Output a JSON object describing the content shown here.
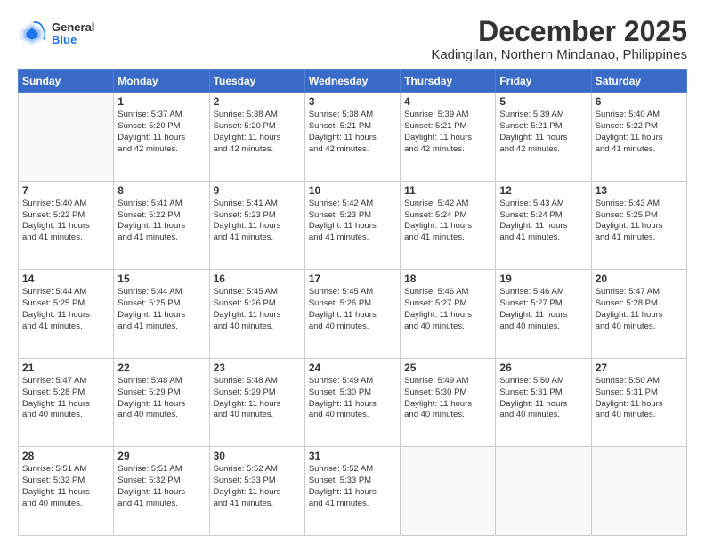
{
  "logo": {
    "general": "General",
    "blue": "Blue"
  },
  "title": "December 2025",
  "subtitle": "Kadingilan, Northern Mindanao, Philippines",
  "days_of_week": [
    "Sunday",
    "Monday",
    "Tuesday",
    "Wednesday",
    "Thursday",
    "Friday",
    "Saturday"
  ],
  "weeks": [
    [
      {
        "day": "",
        "content": ""
      },
      {
        "day": "1",
        "content": "Sunrise: 5:37 AM\nSunset: 5:20 PM\nDaylight: 11 hours\nand 42 minutes."
      },
      {
        "day": "2",
        "content": "Sunrise: 5:38 AM\nSunset: 5:20 PM\nDaylight: 11 hours\nand 42 minutes."
      },
      {
        "day": "3",
        "content": "Sunrise: 5:38 AM\nSunset: 5:21 PM\nDaylight: 11 hours\nand 42 minutes."
      },
      {
        "day": "4",
        "content": "Sunrise: 5:39 AM\nSunset: 5:21 PM\nDaylight: 11 hours\nand 42 minutes."
      },
      {
        "day": "5",
        "content": "Sunrise: 5:39 AM\nSunset: 5:21 PM\nDaylight: 11 hours\nand 42 minutes."
      },
      {
        "day": "6",
        "content": "Sunrise: 5:40 AM\nSunset: 5:22 PM\nDaylight: 11 hours\nand 41 minutes."
      }
    ],
    [
      {
        "day": "7",
        "content": "Sunrise: 5:40 AM\nSunset: 5:22 PM\nDaylight: 11 hours\nand 41 minutes."
      },
      {
        "day": "8",
        "content": "Sunrise: 5:41 AM\nSunset: 5:22 PM\nDaylight: 11 hours\nand 41 minutes."
      },
      {
        "day": "9",
        "content": "Sunrise: 5:41 AM\nSunset: 5:23 PM\nDaylight: 11 hours\nand 41 minutes."
      },
      {
        "day": "10",
        "content": "Sunrise: 5:42 AM\nSunset: 5:23 PM\nDaylight: 11 hours\nand 41 minutes."
      },
      {
        "day": "11",
        "content": "Sunrise: 5:42 AM\nSunset: 5:24 PM\nDaylight: 11 hours\nand 41 minutes."
      },
      {
        "day": "12",
        "content": "Sunrise: 5:43 AM\nSunset: 5:24 PM\nDaylight: 11 hours\nand 41 minutes."
      },
      {
        "day": "13",
        "content": "Sunrise: 5:43 AM\nSunset: 5:25 PM\nDaylight: 11 hours\nand 41 minutes."
      }
    ],
    [
      {
        "day": "14",
        "content": "Sunrise: 5:44 AM\nSunset: 5:25 PM\nDaylight: 11 hours\nand 41 minutes."
      },
      {
        "day": "15",
        "content": "Sunrise: 5:44 AM\nSunset: 5:25 PM\nDaylight: 11 hours\nand 41 minutes."
      },
      {
        "day": "16",
        "content": "Sunrise: 5:45 AM\nSunset: 5:26 PM\nDaylight: 11 hours\nand 40 minutes."
      },
      {
        "day": "17",
        "content": "Sunrise: 5:45 AM\nSunset: 5:26 PM\nDaylight: 11 hours\nand 40 minutes."
      },
      {
        "day": "18",
        "content": "Sunrise: 5:46 AM\nSunset: 5:27 PM\nDaylight: 11 hours\nand 40 minutes."
      },
      {
        "day": "19",
        "content": "Sunrise: 5:46 AM\nSunset: 5:27 PM\nDaylight: 11 hours\nand 40 minutes."
      },
      {
        "day": "20",
        "content": "Sunrise: 5:47 AM\nSunset: 5:28 PM\nDaylight: 11 hours\nand 40 minutes."
      }
    ],
    [
      {
        "day": "21",
        "content": "Sunrise: 5:47 AM\nSunset: 5:28 PM\nDaylight: 11 hours\nand 40 minutes."
      },
      {
        "day": "22",
        "content": "Sunrise: 5:48 AM\nSunset: 5:29 PM\nDaylight: 11 hours\nand 40 minutes."
      },
      {
        "day": "23",
        "content": "Sunrise: 5:48 AM\nSunset: 5:29 PM\nDaylight: 11 hours\nand 40 minutes."
      },
      {
        "day": "24",
        "content": "Sunrise: 5:49 AM\nSunset: 5:30 PM\nDaylight: 11 hours\nand 40 minutes."
      },
      {
        "day": "25",
        "content": "Sunrise: 5:49 AM\nSunset: 5:30 PM\nDaylight: 11 hours\nand 40 minutes."
      },
      {
        "day": "26",
        "content": "Sunrise: 5:50 AM\nSunset: 5:31 PM\nDaylight: 11 hours\nand 40 minutes."
      },
      {
        "day": "27",
        "content": "Sunrise: 5:50 AM\nSunset: 5:31 PM\nDaylight: 11 hours\nand 40 minutes."
      }
    ],
    [
      {
        "day": "28",
        "content": "Sunrise: 5:51 AM\nSunset: 5:32 PM\nDaylight: 11 hours\nand 40 minutes."
      },
      {
        "day": "29",
        "content": "Sunrise: 5:51 AM\nSunset: 5:32 PM\nDaylight: 11 hours\nand 41 minutes."
      },
      {
        "day": "30",
        "content": "Sunrise: 5:52 AM\nSunset: 5:33 PM\nDaylight: 11 hours\nand 41 minutes."
      },
      {
        "day": "31",
        "content": "Sunrise: 5:52 AM\nSunset: 5:33 PM\nDaylight: 11 hours\nand 41 minutes."
      },
      {
        "day": "",
        "content": ""
      },
      {
        "day": "",
        "content": ""
      },
      {
        "day": "",
        "content": ""
      }
    ]
  ]
}
